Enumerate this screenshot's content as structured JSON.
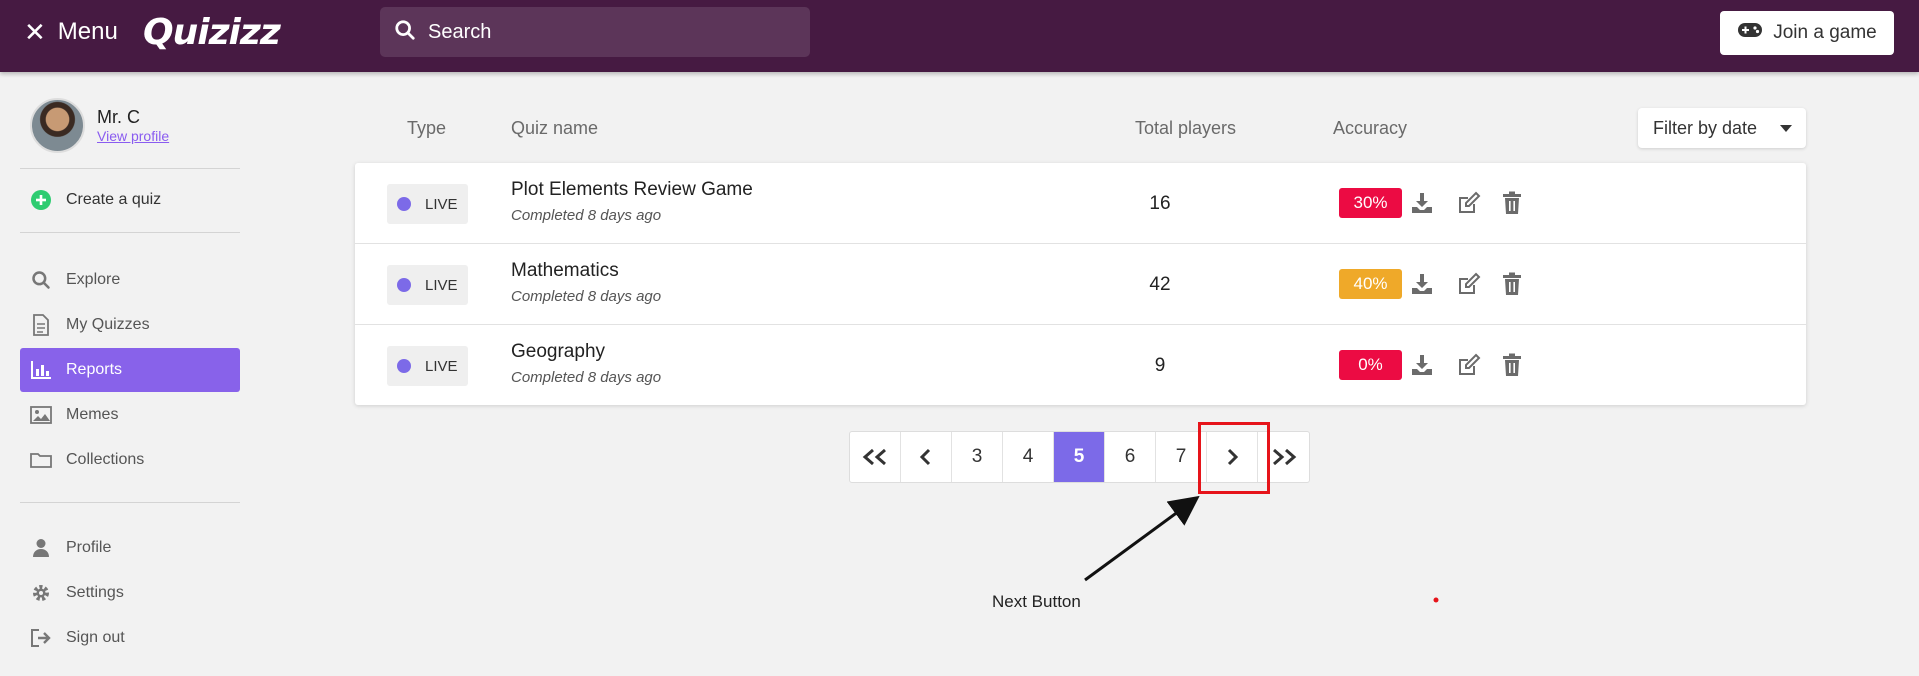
{
  "header": {
    "menu_label": "Menu",
    "logo": "Quizizz",
    "search_placeholder": "Search",
    "join_label": "Join a game",
    "bg_color": "#461a42"
  },
  "sidebar": {
    "profile": {
      "name": "Mr. C",
      "link": "View profile"
    },
    "create_label": "Create a quiz",
    "nav": [
      {
        "label": "Explore",
        "icon": "search-icon"
      },
      {
        "label": "My Quizzes",
        "icon": "document-icon"
      },
      {
        "label": "Reports",
        "icon": "bar-chart-icon",
        "active": true
      },
      {
        "label": "Memes",
        "icon": "image-icon"
      },
      {
        "label": "Collections",
        "icon": "folder-icon"
      }
    ],
    "account": [
      {
        "label": "Profile",
        "icon": "user-icon"
      },
      {
        "label": "Settings",
        "icon": "gear-icon"
      },
      {
        "label": "Sign out",
        "icon": "sign-out-icon"
      }
    ],
    "accent_color": "#8862ea"
  },
  "table": {
    "headers": {
      "type": "Type",
      "quiz_name": "Quiz name",
      "total_players": "Total players",
      "accuracy": "Accuracy"
    },
    "filter_label": "Filter by date",
    "rows": [
      {
        "type": "LIVE",
        "name": "Plot Elements Review Game",
        "sub": "Completed 8 days ago",
        "players": "16",
        "accuracy": "30%",
        "accuracy_color": "#ec0b43"
      },
      {
        "type": "LIVE",
        "name": "Mathematics",
        "sub": "Completed 8 days ago",
        "players": "42",
        "accuracy": "40%",
        "accuracy_color": "#efa929"
      },
      {
        "type": "LIVE",
        "name": "Geography",
        "sub": "Completed 8 days ago",
        "players": "9",
        "accuracy": "0%",
        "accuracy_color": "#ec0b43"
      }
    ]
  },
  "pagination": {
    "first": "<<",
    "prev": "<",
    "pages": [
      "3",
      "4",
      "5",
      "6",
      "7"
    ],
    "current": "5",
    "next": ">",
    "last": ">>"
  },
  "annotation": {
    "label": "Next Button",
    "color": "#e6141a"
  }
}
